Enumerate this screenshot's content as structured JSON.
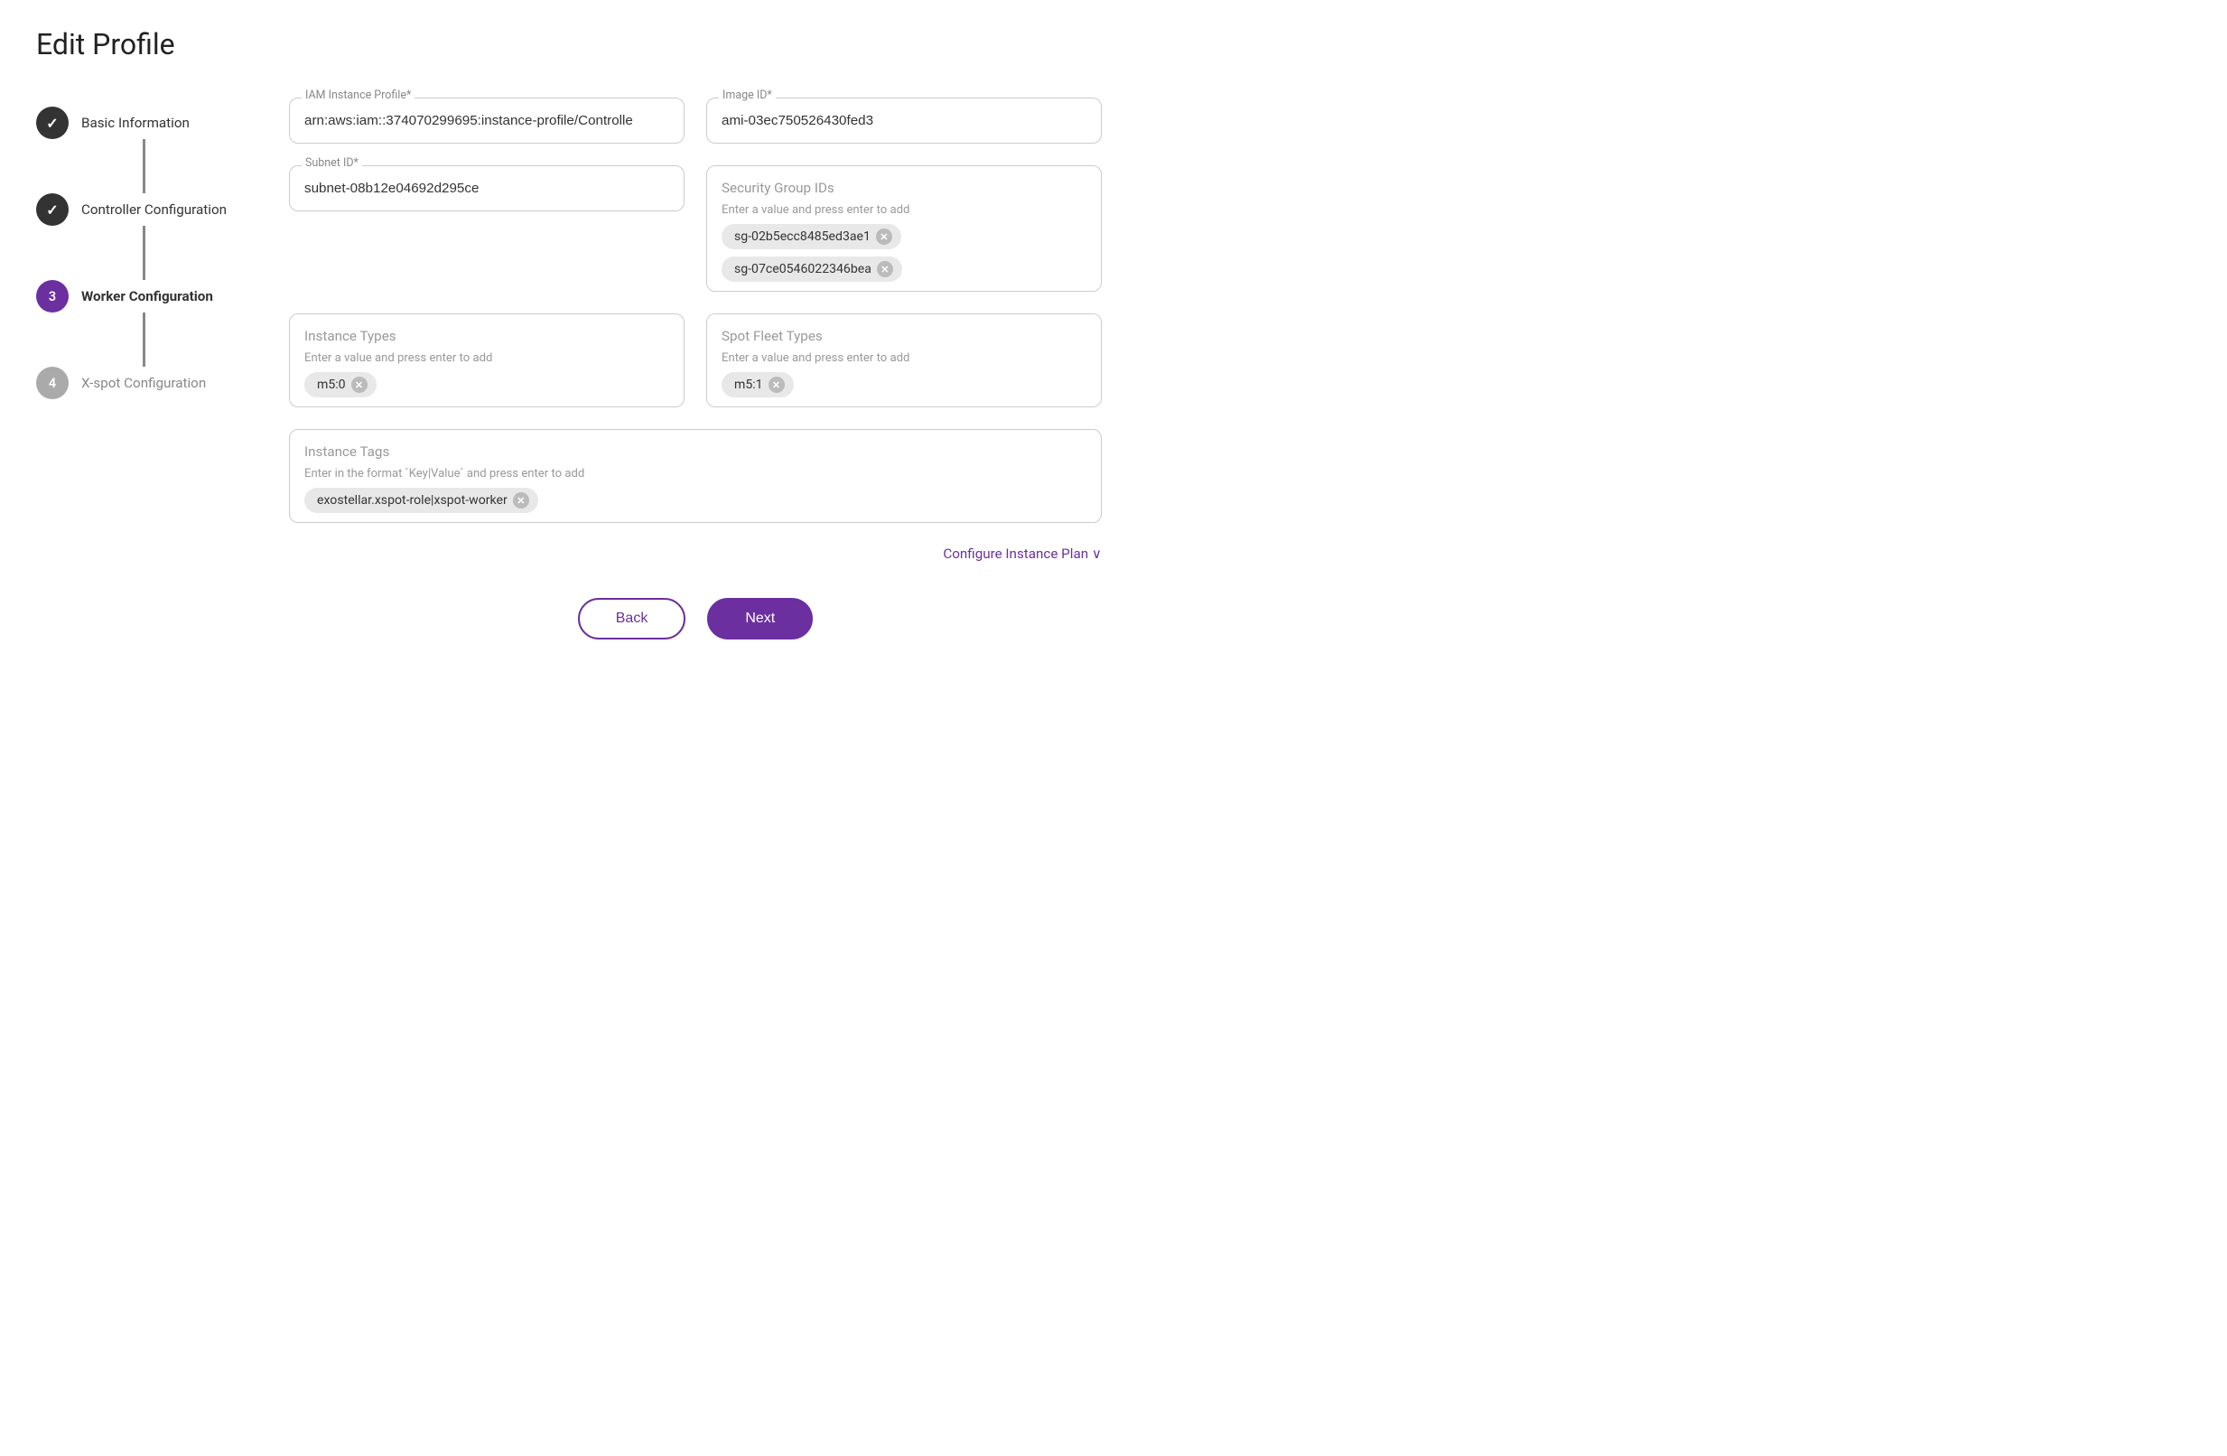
{
  "page": {
    "title": "Edit Profile"
  },
  "stepper": {
    "items": [
      {
        "id": "step-basic",
        "label": "Basic Information",
        "state": "done",
        "number": "✓"
      },
      {
        "id": "step-controller",
        "label": "Controller Configuration",
        "state": "done",
        "number": "✓"
      },
      {
        "id": "step-worker",
        "label": "Worker Configuration",
        "state": "active",
        "number": "3"
      },
      {
        "id": "step-xspot",
        "label": "X-spot Configuration",
        "state": "inactive",
        "number": "4"
      }
    ]
  },
  "form": {
    "iam_label": "IAM Instance Profile*",
    "iam_value": "arn:aws:iam::374070299695:instance-profile/Controlle",
    "image_label": "Image ID*",
    "image_value": "ami-03ec750526430fed3",
    "subnet_label": "Subnet ID*",
    "subnet_value": "subnet-08b12e04692d295ce",
    "security_group_label": "Security Group IDs",
    "security_group_hint": "Enter a value and press enter to add",
    "security_groups": [
      {
        "value": "sg-02b5ecc8485ed3ae1"
      },
      {
        "value": "sg-07ce0546022346bea"
      }
    ],
    "instance_types_label": "Instance Types",
    "instance_types_hint": "Enter a value and press enter to add",
    "instance_types": [
      {
        "value": "m5:0"
      }
    ],
    "spot_fleet_label": "Spot Fleet Types",
    "spot_fleet_hint": "Enter a value and press enter to add",
    "spot_fleet_types": [
      {
        "value": "m5:1"
      }
    ],
    "instance_tags_label": "Instance Tags",
    "instance_tags_hint": "Enter in the format `Key|Value` and press enter to add",
    "instance_tags": [
      {
        "value": "exostellar.xspot-role|xspot-worker"
      }
    ],
    "configure_plan_label": "Configure Instance Plan",
    "configure_plan_icon": "chevron-down"
  },
  "buttons": {
    "back_label": "Back",
    "next_label": "Next"
  }
}
